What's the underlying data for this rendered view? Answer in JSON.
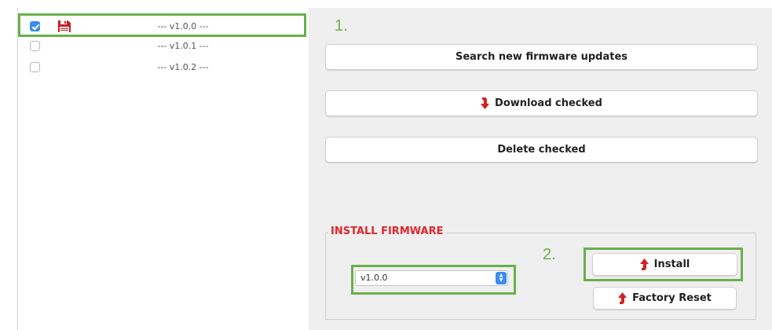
{
  "firmware_list": {
    "items": [
      {
        "label": "--- v1.0.0 ---",
        "checked": true,
        "downloaded": true
      },
      {
        "label": "--- v1.0.1 ---",
        "checked": false,
        "downloaded": false
      },
      {
        "label": "--- v1.0.2 ---",
        "checked": false,
        "downloaded": false
      }
    ]
  },
  "steps": {
    "step1": "1.",
    "step2": "2."
  },
  "actions": {
    "search_label": "Search new firmware updates",
    "download_label": "Download checked",
    "delete_label": "Delete checked"
  },
  "install_firmware": {
    "title": "INSTALL FIRMWARE",
    "selected_version": "v1.0.0",
    "install_label": "Install",
    "factory_reset_label": "Factory Reset"
  },
  "icons": {
    "floppy": "floppy-disk-icon",
    "download": "arrow-down-icon",
    "upload": "arrow-up-icon"
  },
  "colors": {
    "highlight": "#6ab04c",
    "accent_red": "#e3262a",
    "checkbox_blue": "#3b8cf0",
    "panel_bg": "#efefef"
  }
}
